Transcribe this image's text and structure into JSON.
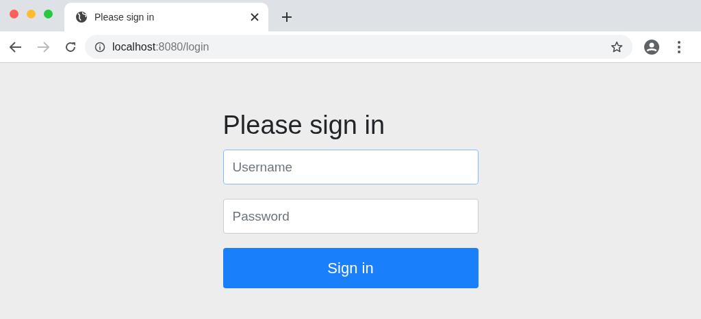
{
  "tabs": [
    {
      "title": "Please sign in",
      "selected": true
    }
  ],
  "address_bar": {
    "host": "localhost",
    "path": ":8080/login"
  },
  "form": {
    "heading": "Please sign in",
    "fields": [
      {
        "placeholder": "Username",
        "focused": true
      },
      {
        "placeholder": "Password",
        "focused": false
      }
    ],
    "submit": "Sign in"
  }
}
